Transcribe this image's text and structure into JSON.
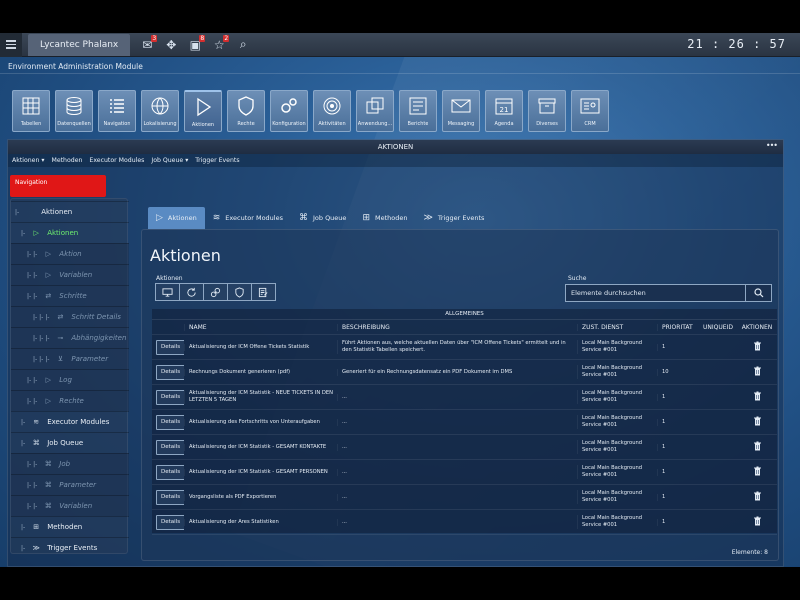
{
  "app": {
    "title": "Lycantec Phalanx",
    "clock": "21 : 26 : 57",
    "module": "Environment Administration Module"
  },
  "topbar": {
    "icons": [
      {
        "icon": "mail-icon",
        "badge": "3"
      },
      {
        "icon": "move-icon",
        "badge": ""
      },
      {
        "icon": "calendar-icon",
        "badge": "8"
      },
      {
        "icon": "star-icon",
        "badge": "2"
      },
      {
        "icon": "search-icon",
        "badge": ""
      }
    ]
  },
  "tiles": [
    {
      "label": "Tabellen",
      "icon": "table"
    },
    {
      "label": "Datenquellen",
      "icon": "database"
    },
    {
      "label": "Navigation",
      "icon": "list"
    },
    {
      "label": "Lokalisierung",
      "icon": "globe"
    },
    {
      "label": "Aktionen",
      "icon": "play",
      "active": true
    },
    {
      "label": "Rechte",
      "icon": "shield"
    },
    {
      "label": "Konfiguration",
      "icon": "gears"
    },
    {
      "label": "Aktivitäten",
      "icon": "target"
    },
    {
      "label": "Anwendung...",
      "icon": "windows"
    },
    {
      "label": "Berichte",
      "icon": "report"
    },
    {
      "label": "Messaging",
      "icon": "envelope"
    },
    {
      "label": "Agenda",
      "icon": "calendar21"
    },
    {
      "label": "Diverses",
      "icon": "box"
    },
    {
      "label": "CRM",
      "icon": "card"
    }
  ],
  "panel": {
    "title": "AKTIONEN",
    "dots": "•••"
  },
  "actionbar": [
    {
      "label": "Aktionen ▾"
    },
    {
      "label": "Methoden"
    },
    {
      "label": "Executor Modules"
    },
    {
      "label": "Job Queue ▾"
    },
    {
      "label": "Trigger Events"
    }
  ],
  "nav": {
    "header": "Navigation",
    "items": [
      {
        "pipe": "|-",
        "label": "Aktionen",
        "icon": "",
        "indent": 0,
        "style": "root"
      },
      {
        "pipe": "|-",
        "label": "Aktionen",
        "icon": "▷",
        "indent": 1,
        "style": "sel"
      },
      {
        "pipe": "|- |-",
        "label": "Aktion",
        "icon": "▷",
        "indent": 2,
        "style": "italic"
      },
      {
        "pipe": "|- |-",
        "label": "Variablen",
        "icon": "▷",
        "indent": 2,
        "style": "italic"
      },
      {
        "pipe": "|- |-",
        "label": "Schritte",
        "icon": "⇄",
        "indent": 2,
        "style": "italic"
      },
      {
        "pipe": "|- |- |-",
        "label": "Schritt Details",
        "icon": "⇄",
        "indent": 3,
        "style": "italic"
      },
      {
        "pipe": "|- |- |-",
        "label": "Abhängigkeiten",
        "icon": "⊸",
        "indent": 3,
        "style": "italic"
      },
      {
        "pipe": "|- |- |-",
        "label": "Parameter",
        "icon": "⊻",
        "indent": 3,
        "style": "italic"
      },
      {
        "pipe": "|- |-",
        "label": "Log",
        "icon": "▷",
        "indent": 2,
        "style": "italic"
      },
      {
        "pipe": "|- |-",
        "label": "Rechte",
        "icon": "▷",
        "indent": 2,
        "style": "italic"
      },
      {
        "pipe": "|-",
        "label": "Executor Modules",
        "icon": "≋",
        "indent": 1,
        "style": "normal"
      },
      {
        "pipe": "|-",
        "label": "Job Queue",
        "icon": "⌘",
        "indent": 1,
        "style": "normal"
      },
      {
        "pipe": "|- |-",
        "label": "Job",
        "icon": "⌘",
        "indent": 2,
        "style": "italic"
      },
      {
        "pipe": "|- |-",
        "label": "Parameter",
        "icon": "⌘",
        "indent": 2,
        "style": "italic"
      },
      {
        "pipe": "|- |-",
        "label": "Variablen",
        "icon": "⌘",
        "indent": 2,
        "style": "italic"
      },
      {
        "pipe": "|-",
        "label": "Methoden",
        "icon": "⊞",
        "indent": 1,
        "style": "normal"
      },
      {
        "pipe": "|-",
        "label": "Trigger Events",
        "icon": "≫",
        "indent": 1,
        "style": "normal"
      }
    ]
  },
  "tabs": [
    {
      "label": "Aktionen",
      "icon": "▷",
      "active": true
    },
    {
      "label": "Executor Modules",
      "icon": "≋"
    },
    {
      "label": "Job Queue",
      "icon": "⌘"
    },
    {
      "label": "Methoden",
      "icon": "⊞"
    },
    {
      "label": "Trigger Events",
      "icon": "≫"
    }
  ],
  "main": {
    "title": "Aktionen",
    "actions_label": "Aktionen",
    "search_label": "Suche",
    "search_placeholder": "Elemente durchsuchen",
    "group_header": "ALLGEMEINES",
    "columns": [
      "",
      "NAME",
      "BESCHREIBUNG",
      "ZUST. DIENST",
      "PRIORITÄT",
      "UNIQUEID",
      "AKTIONEN"
    ],
    "details_label": "Details",
    "rows": [
      {
        "name": "Aktualisierung der ICM Offene Tickets Statistik",
        "desc": "Führt Aktionen aus, welche aktuellen Daten über \"ICM Offene Tickets\" ermittelt und in den Statistik Tabellen speichert.",
        "service": "Local Main Background Service #001",
        "prio": "1",
        "uid": ""
      },
      {
        "name": "Rechnungs Dokument generieren (pdf)",
        "desc": "Generiert für ein Rechnungsdatensatz ein PDF Dokument im DMS",
        "service": "Local Main Background Service #001",
        "prio": "10",
        "uid": ""
      },
      {
        "name": "Aktualisierung der ICM Statistik - NEUE TICKETS IN DEN LETZTEN 5 TAGEN",
        "desc": "...",
        "service": "Local Main Background Service #001",
        "prio": "1",
        "uid": ""
      },
      {
        "name": "Aktualisierung des Fortschritts von Unteraufgaben",
        "desc": "...",
        "service": "Local Main Background Service #001",
        "prio": "1",
        "uid": ""
      },
      {
        "name": "Aktualisierung der ICM Statistik - GESAMT KONTAKTE",
        "desc": "...",
        "service": "Local Main Background Service #001",
        "prio": "1",
        "uid": ""
      },
      {
        "name": "Aktualisierung der ICM Statistik - GESAMT PERSONEN",
        "desc": "...",
        "service": "Local Main Background Service #001",
        "prio": "1",
        "uid": ""
      },
      {
        "name": "Vorgangsliste als PDF Exportieren",
        "desc": "...",
        "service": "Local Main Background Service #001",
        "prio": "1",
        "uid": ""
      },
      {
        "name": "Aktualisierung der Ares Statistiken",
        "desc": "...",
        "service": "Local Main Background Service #001",
        "prio": "1",
        "uid": ""
      }
    ],
    "count_label": "Elemente: 8"
  }
}
